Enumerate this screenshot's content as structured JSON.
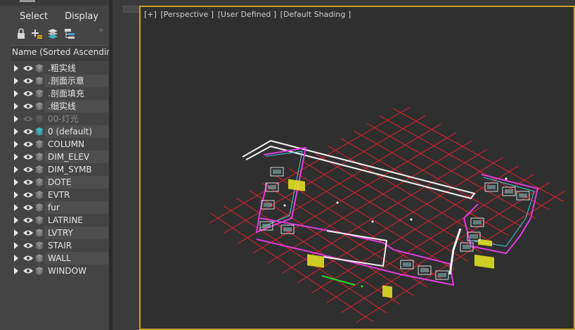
{
  "menu": {
    "select": "Select",
    "display": "Display"
  },
  "toolbar": {
    "icons": [
      "lock-icon",
      "create-layer-icon",
      "layers-icon",
      "hierarchy-icon"
    ]
  },
  "list": {
    "header": "Name (Sorted Ascending",
    "rows": [
      {
        "label": ".粗实线"
      },
      {
        "label": ".剖面示意"
      },
      {
        "label": ".剖面填充"
      },
      {
        "label": ".细实线"
      },
      {
        "label": "00-灯光"
      },
      {
        "label": "0 (default)"
      },
      {
        "label": "COLUMN"
      },
      {
        "label": "DIM_ELEV"
      },
      {
        "label": "DIM_SYMB"
      },
      {
        "label": "DOTE"
      },
      {
        "label": "EVTR"
      },
      {
        "label": "fur"
      },
      {
        "label": "LATRINE"
      },
      {
        "label": "LVTRY"
      },
      {
        "label": "STAIR"
      },
      {
        "label": "WALL"
      },
      {
        "label": "WINDOW"
      }
    ]
  },
  "viewport": {
    "labels": [
      "[+]",
      "[Perspective ]",
      "[User Defined ]",
      "[Default Shading ]"
    ]
  },
  "colors": {
    "active_border": "#c9a227",
    "grid_red": "#e0202a",
    "wall_white": "#f2f2f2",
    "magenta": "#e23be2",
    "cyan": "#38d0e0",
    "yellow": "#e8e820",
    "green": "#22dd22",
    "active_layer": "#3fb6c8"
  }
}
